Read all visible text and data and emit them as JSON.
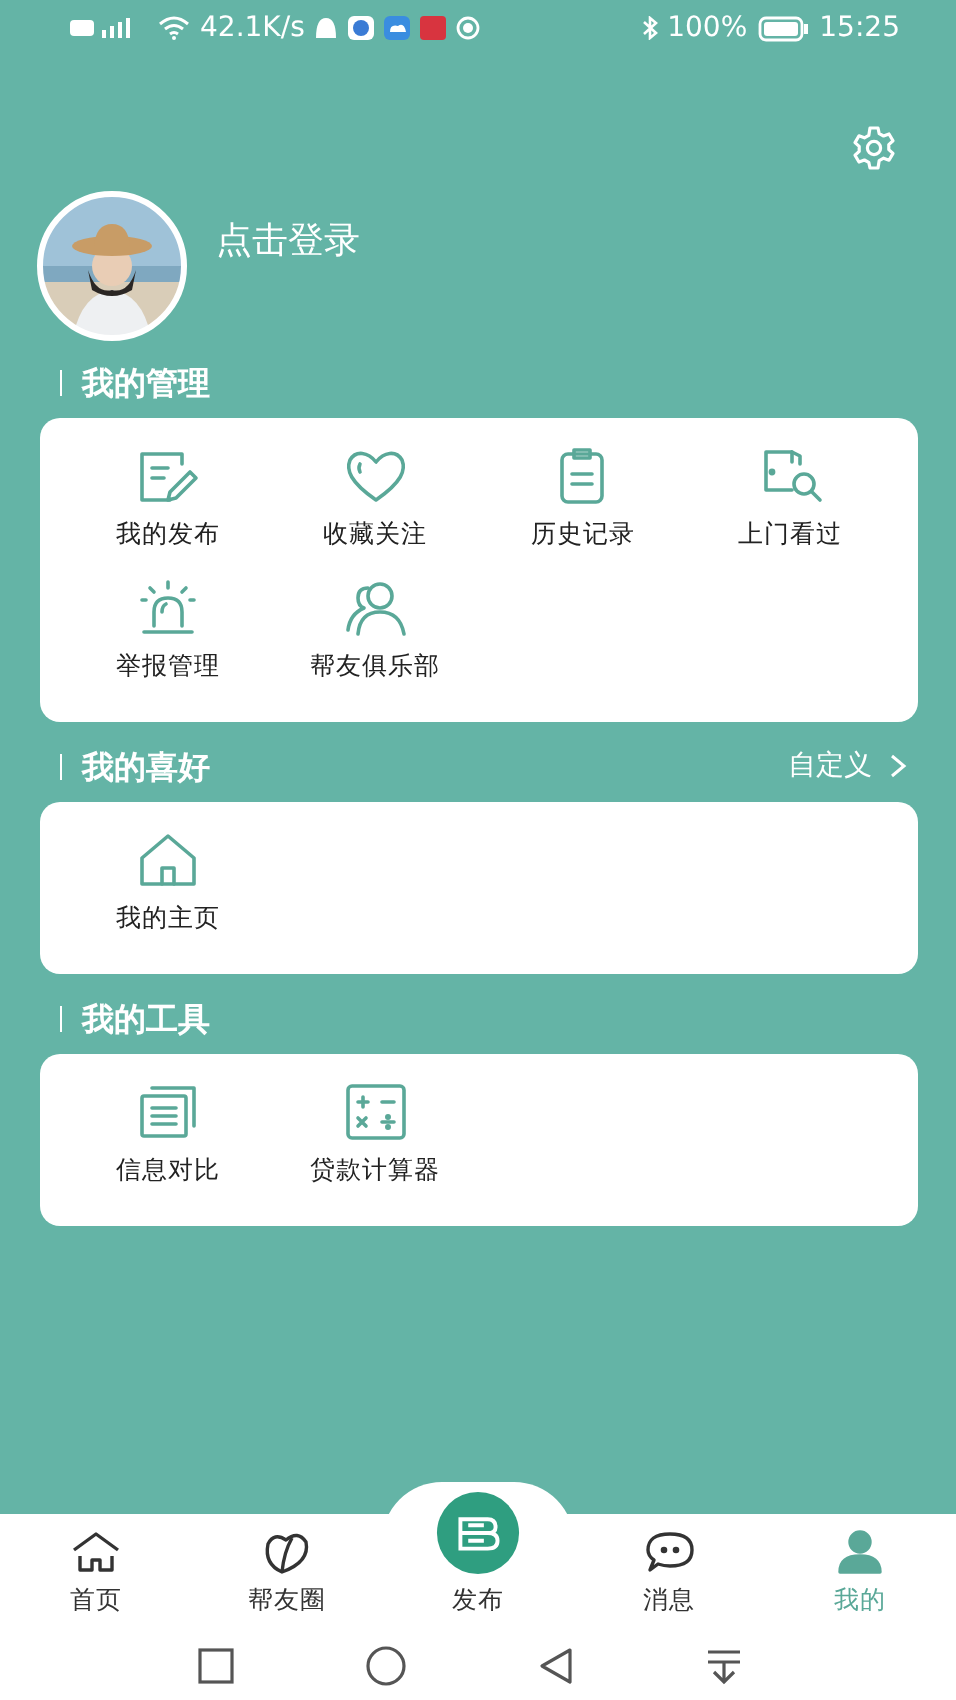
{
  "status_bar": {
    "speed": "42.1K/s",
    "battery": "100%",
    "time": "15:25"
  },
  "profile": {
    "login": "点击登录"
  },
  "sections": [
    {
      "title": "我的管理",
      "items": [
        {
          "label": "我的发布"
        },
        {
          "label": "收藏关注"
        },
        {
          "label": "历史记录"
        },
        {
          "label": "上门看过"
        },
        {
          "label": "举报管理"
        },
        {
          "label": "帮友俱乐部"
        }
      ]
    },
    {
      "title": "我的喜好",
      "action": "自定义",
      "items": [
        {
          "label": "我的主页"
        }
      ]
    },
    {
      "title": "我的工具",
      "items": [
        {
          "label": "信息对比"
        },
        {
          "label": "贷款计算器"
        }
      ]
    }
  ],
  "tabs": [
    {
      "label": "首页",
      "selected": false
    },
    {
      "label": "帮友圈",
      "selected": false
    },
    {
      "label": "发布",
      "selected": false
    },
    {
      "label": "消息",
      "selected": false
    },
    {
      "label": "我的",
      "selected": true
    }
  ]
}
